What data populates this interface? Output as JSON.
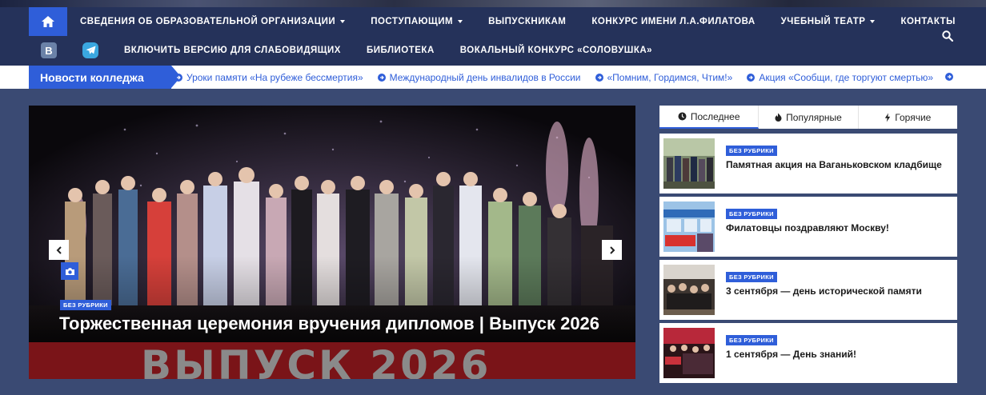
{
  "nav": {
    "home_icon": "home-icon",
    "row1": [
      {
        "label": "СВЕДЕНИЯ ОБ ОБРАЗОВАТЕЛЬНОЙ ОРГАНИЗАЦИИ",
        "dropdown": true
      },
      {
        "label": "ПОСТУПАЮЩИМ",
        "dropdown": true
      },
      {
        "label": "ВЫПУСКНИКАМ",
        "dropdown": false
      },
      {
        "label": "КОНКУРС ИМЕНИ Л.А.ФИЛАТОВА",
        "dropdown": false
      },
      {
        "label": "УЧЕБНЫЙ ТЕАТР",
        "dropdown": true
      },
      {
        "label": "КОНТАКТЫ",
        "dropdown": false
      }
    ],
    "row2": [
      {
        "label": "ВКЛЮЧИТЬ ВЕРСИЮ ДЛЯ СЛАБОВИДЯЩИХ"
      },
      {
        "label": "БИБЛИОТЕКА"
      },
      {
        "label": "ВОКАЛЬНЫЙ КОНКУРС «СОЛОВУШКА»"
      }
    ],
    "vk_label": "В",
    "search_icon": "search-icon"
  },
  "ticker": {
    "label": "Новости колледжа",
    "items": [
      "Уроки памяти «На рубеже бессмертия»",
      "Международный день инвалидов в России",
      "«Помним, Гордимся, Чтим!»",
      "Акция «Сообщи, где торгуют смертью»"
    ]
  },
  "slider": {
    "badge": "БЕЗ РУБРИКИ",
    "title": "Торжественная церемония вручения дипломов | Выпуск 2026",
    "banner_text": "ВЫПУСК 2026"
  },
  "sidebar": {
    "tabs": [
      {
        "label": "Последнее",
        "icon": "clock-icon",
        "active": true
      },
      {
        "label": "Популярные",
        "icon": "fire-icon",
        "active": false
      },
      {
        "label": "Горячие",
        "icon": "bolt-icon",
        "active": false
      }
    ],
    "posts": [
      {
        "badge": "БЕЗ РУБРИКИ",
        "title": "Памятная акция на Ваганьковском кладбище"
      },
      {
        "badge": "БЕЗ РУБРИКИ",
        "title": "Филатовцы поздравляют Москву!"
      },
      {
        "badge": "БЕЗ РУБРИКИ",
        "title": "3 сентября — день исторической памяти"
      },
      {
        "badge": "БЕЗ РУБРИКИ",
        "title": "1 сентября — День знаний!"
      }
    ]
  },
  "colors": {
    "nav_bg": "#25325a",
    "accent": "#2f5ed9",
    "page_bg": "#3a4a73"
  }
}
